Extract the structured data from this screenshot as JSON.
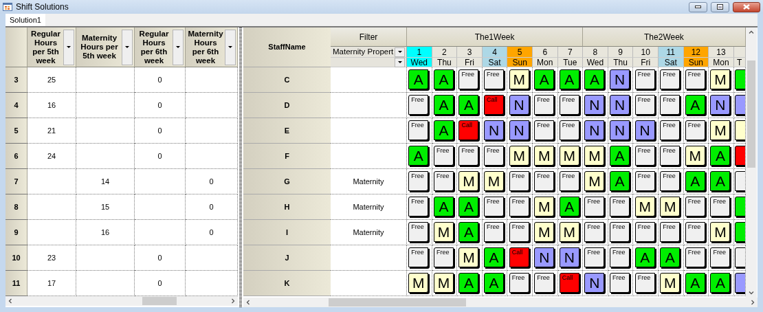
{
  "window": {
    "title": "Shift Solutions"
  },
  "tabs": [
    {
      "label": "Solution1",
      "selected": true
    }
  ],
  "left_grid": {
    "columns": [
      "Regular Hours per 5th week",
      "Maternity Hours per 5th week",
      "Regular Hours per 6th week",
      "Maternity Hours per 6th week"
    ],
    "rows": [
      {
        "row_number": "3",
        "regular_5": "25",
        "regular_6": "0"
      },
      {
        "row_number": "4",
        "regular_5": "16",
        "regular_6": "0"
      },
      {
        "row_number": "5",
        "regular_5": "21",
        "regular_6": "0"
      },
      {
        "row_number": "6",
        "regular_5": "24",
        "regular_6": "0"
      },
      {
        "row_number": "7",
        "maternity_5": "14",
        "maternity_6": "0"
      },
      {
        "row_number": "8",
        "maternity_5": "15",
        "maternity_6": "0"
      },
      {
        "row_number": "9",
        "maternity_5": "16",
        "maternity_6": "0"
      },
      {
        "row_number": "10",
        "regular_5": "23",
        "regular_6": "0"
      },
      {
        "row_number": "11",
        "regular_5": "17",
        "regular_6": "0"
      }
    ]
  },
  "schedule": {
    "staff_header": "StaffName",
    "filter_header": "Filter",
    "filter_fields": [
      {
        "kind": "value",
        "value": "Maternity Propert"
      },
      {
        "kind": "blank"
      }
    ],
    "weeks": [
      {
        "label": "The1Week",
        "days": [
          {
            "number": "1",
            "day": "Wed",
            "kind": "today"
          },
          {
            "number": "2",
            "day": "Thu",
            "kind": "weekday"
          },
          {
            "number": "3",
            "day": "Fri",
            "kind": "weekday"
          },
          {
            "number": "4",
            "day": "Sat",
            "kind": "saturday"
          },
          {
            "number": "5",
            "day": "Sun",
            "kind": "sunday"
          },
          {
            "number": "6",
            "day": "Mon",
            "kind": "weekday"
          },
          {
            "number": "7",
            "day": "Tue",
            "kind": "weekday"
          }
        ]
      },
      {
        "label": "The2Week",
        "days": [
          {
            "number": "8",
            "day": "Wed",
            "kind": "weekday"
          },
          {
            "number": "9",
            "day": "Thu",
            "kind": "weekday"
          },
          {
            "number": "10",
            "day": "Fri",
            "kind": "weekday"
          },
          {
            "number": "11",
            "day": "Sat",
            "kind": "saturday"
          },
          {
            "number": "12",
            "day": "Sun",
            "kind": "sunday"
          },
          {
            "number": "13",
            "day": "Mon",
            "kind": "weekday"
          },
          {
            "day": "T",
            "kind": "weekday"
          }
        ]
      }
    ],
    "rows": [
      {
        "name": "C",
        "shifts": [
          {
            "kind": "A",
            "label": "A"
          },
          {
            "kind": "A",
            "label": "A"
          },
          {
            "kind": "free",
            "label": "Free"
          },
          {
            "kind": "free",
            "label": "Free"
          },
          {
            "kind": "M",
            "label": "M"
          },
          {
            "kind": "A",
            "label": "A"
          },
          {
            "kind": "A",
            "label": "A"
          },
          {
            "kind": "A",
            "label": "A"
          },
          {
            "kind": "N",
            "label": "N"
          },
          {
            "kind": "free",
            "label": "Free"
          },
          {
            "kind": "free",
            "label": "Free"
          },
          {
            "kind": "free",
            "label": "Free"
          },
          {
            "kind": "M",
            "label": "M"
          },
          {
            "kind": "A"
          }
        ]
      },
      {
        "name": "D",
        "shifts": [
          {
            "kind": "free",
            "label": "Free"
          },
          {
            "kind": "A",
            "label": "A"
          },
          {
            "kind": "A",
            "label": "A"
          },
          {
            "kind": "call",
            "label": "Call"
          },
          {
            "kind": "N",
            "label": "N"
          },
          {
            "kind": "free",
            "label": "Free"
          },
          {
            "kind": "free",
            "label": "Free"
          },
          {
            "kind": "N",
            "label": "N"
          },
          {
            "kind": "N",
            "label": "N"
          },
          {
            "kind": "free",
            "label": "Free"
          },
          {
            "kind": "free",
            "label": "Free"
          },
          {
            "kind": "A",
            "label": "A"
          },
          {
            "kind": "N",
            "label": "N"
          },
          {
            "kind": "N"
          }
        ]
      },
      {
        "name": "E",
        "shifts": [
          {
            "kind": "free",
            "label": "Free"
          },
          {
            "kind": "A",
            "label": "A"
          },
          {
            "kind": "call",
            "label": "Call"
          },
          {
            "kind": "N",
            "label": "N"
          },
          {
            "kind": "N",
            "label": "N"
          },
          {
            "kind": "free",
            "label": "Free"
          },
          {
            "kind": "free",
            "label": "Free"
          },
          {
            "kind": "N",
            "label": "N"
          },
          {
            "kind": "N",
            "label": "N"
          },
          {
            "kind": "N",
            "label": "N"
          },
          {
            "kind": "free",
            "label": "Free"
          },
          {
            "kind": "free",
            "label": "Free"
          },
          {
            "kind": "M",
            "label": "M"
          },
          {
            "kind": "M"
          }
        ]
      },
      {
        "name": "F",
        "shifts": [
          {
            "kind": "A",
            "label": "A"
          },
          {
            "kind": "free",
            "label": "Free"
          },
          {
            "kind": "free",
            "label": "Free"
          },
          {
            "kind": "free",
            "label": "Free"
          },
          {
            "kind": "M",
            "label": "M"
          },
          {
            "kind": "M",
            "label": "M"
          },
          {
            "kind": "M",
            "label": "M"
          },
          {
            "kind": "M",
            "label": "M"
          },
          {
            "kind": "A",
            "label": "A"
          },
          {
            "kind": "free",
            "label": "Free"
          },
          {
            "kind": "free",
            "label": "Free"
          },
          {
            "kind": "M",
            "label": "M"
          },
          {
            "kind": "A",
            "label": "A"
          },
          {
            "kind": "call"
          }
        ]
      },
      {
        "name": "G",
        "filter": "Maternity",
        "shifts": [
          {
            "kind": "free",
            "label": "Free"
          },
          {
            "kind": "free",
            "label": "Free"
          },
          {
            "kind": "M",
            "label": "M"
          },
          {
            "kind": "M",
            "label": "M"
          },
          {
            "kind": "free",
            "label": "Free"
          },
          {
            "kind": "free",
            "label": "Free"
          },
          {
            "kind": "free",
            "label": "Free"
          },
          {
            "kind": "M",
            "label": "M"
          },
          {
            "kind": "A",
            "label": "A"
          },
          {
            "kind": "free",
            "label": "Free"
          },
          {
            "kind": "free",
            "label": "Free"
          },
          {
            "kind": "A",
            "label": "A"
          },
          {
            "kind": "A",
            "label": "A"
          },
          {
            "kind": "free"
          }
        ]
      },
      {
        "name": "H",
        "filter": "Maternity",
        "shifts": [
          {
            "kind": "free",
            "label": "Free"
          },
          {
            "kind": "A",
            "label": "A"
          },
          {
            "kind": "A",
            "label": "A"
          },
          {
            "kind": "free",
            "label": "Free"
          },
          {
            "kind": "free",
            "label": "Free"
          },
          {
            "kind": "M",
            "label": "M"
          },
          {
            "kind": "A",
            "label": "A"
          },
          {
            "kind": "free",
            "label": "Free"
          },
          {
            "kind": "free",
            "label": "Free"
          },
          {
            "kind": "M",
            "label": "M"
          },
          {
            "kind": "M",
            "label": "M"
          },
          {
            "kind": "free",
            "label": "Free"
          },
          {
            "kind": "free",
            "label": "Free"
          },
          {
            "kind": "A"
          }
        ]
      },
      {
        "name": "I",
        "filter": "Maternity",
        "shifts": [
          {
            "kind": "free",
            "label": "Free"
          },
          {
            "kind": "M",
            "label": "M"
          },
          {
            "kind": "A",
            "label": "A"
          },
          {
            "kind": "free",
            "label": "Free"
          },
          {
            "kind": "free",
            "label": "Free"
          },
          {
            "kind": "M",
            "label": "M"
          },
          {
            "kind": "M",
            "label": "M"
          },
          {
            "kind": "free",
            "label": "Free"
          },
          {
            "kind": "free",
            "label": "Free"
          },
          {
            "kind": "free",
            "label": "Free"
          },
          {
            "kind": "free",
            "label": "Free"
          },
          {
            "kind": "free",
            "label": "Free"
          },
          {
            "kind": "M",
            "label": "M"
          },
          {
            "kind": "A"
          }
        ]
      },
      {
        "name": "J",
        "shifts": [
          {
            "kind": "free",
            "label": "Free"
          },
          {
            "kind": "free",
            "label": "Free"
          },
          {
            "kind": "M",
            "label": "M"
          },
          {
            "kind": "A",
            "label": "A"
          },
          {
            "kind": "call",
            "label": "Call"
          },
          {
            "kind": "N",
            "label": "N"
          },
          {
            "kind": "N",
            "label": "N"
          },
          {
            "kind": "free",
            "label": "Free"
          },
          {
            "kind": "free",
            "label": "Free"
          },
          {
            "kind": "A",
            "label": "A"
          },
          {
            "kind": "A",
            "label": "A"
          },
          {
            "kind": "free",
            "label": "Free"
          },
          {
            "kind": "free",
            "label": "Free"
          },
          {
            "kind": "free"
          }
        ]
      },
      {
        "name": "K",
        "shifts": [
          {
            "kind": "M",
            "label": "M"
          },
          {
            "kind": "M",
            "label": "M"
          },
          {
            "kind": "A",
            "label": "A"
          },
          {
            "kind": "A",
            "label": "A"
          },
          {
            "kind": "free",
            "label": "Free"
          },
          {
            "kind": "free",
            "label": "Free"
          },
          {
            "kind": "call",
            "label": "Call"
          },
          {
            "kind": "N",
            "label": "N"
          },
          {
            "kind": "free",
            "label": "Free"
          },
          {
            "kind": "free",
            "label": "Free"
          },
          {
            "kind": "M",
            "label": "M"
          },
          {
            "kind": "A",
            "label": "A"
          },
          {
            "kind": "A",
            "label": "A"
          },
          {
            "kind": "N"
          }
        ]
      }
    ]
  }
}
